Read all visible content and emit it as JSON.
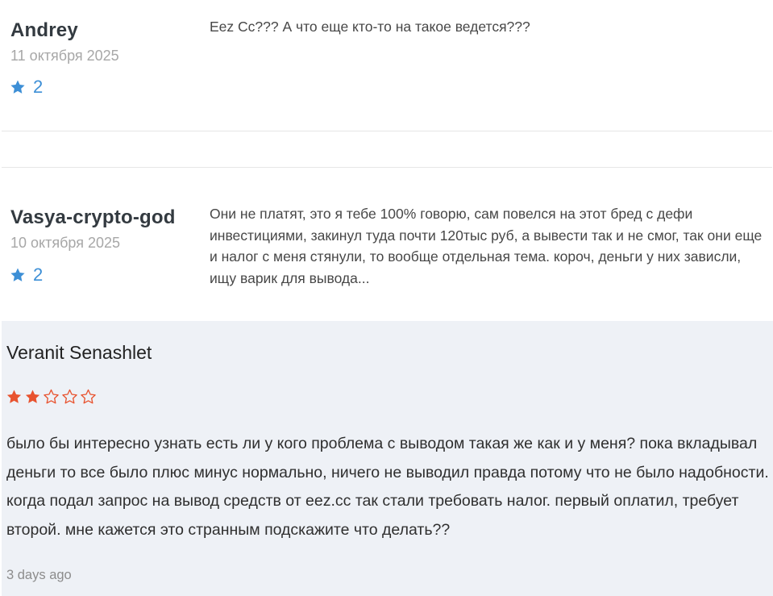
{
  "reviews": [
    {
      "author": "Andrey",
      "date": "11 октября 2025",
      "rating": "2",
      "text": "Eez Cc??? А что еще кто-то на такое ведется???",
      "star_icon": "star-icon",
      "star_color": "#3d8fd6"
    },
    {
      "author": "Vasya-crypto-god",
      "date": "10 октября 2025",
      "rating": "2",
      "text": "Они не платят, это я тебе 100% говорю, сам повелся на этот бред с дефи инвестициями, закинул туда почти 120тыс руб, а вывести так и не смог, так они еще и налог с меня стянули, то вообще отдельная тема. короч, деньги у них зависли, ищу варик для вывода...",
      "star_icon": "star-icon",
      "star_color": "#3d8fd6"
    }
  ],
  "featured_review": {
    "author": "Veranit Senashlet",
    "rating": 2,
    "max_rating": 5,
    "text": "было бы интересно узнать есть ли у кого проблема с выводом такая же как и у меня? пока вкладывал деньги то все было плюс минус нормально, ничего не выводил правда потому что не было надобности. когда подал запрос на вывод средств от eez.cc так стали требовать налог. первый оплатил, требует второй. мне кажется это странным подскажите что делать??",
    "time": "3 days ago",
    "star_filled_color": "#e8532f",
    "star_empty_color": "#e8532f",
    "background": "#eef1f6"
  }
}
